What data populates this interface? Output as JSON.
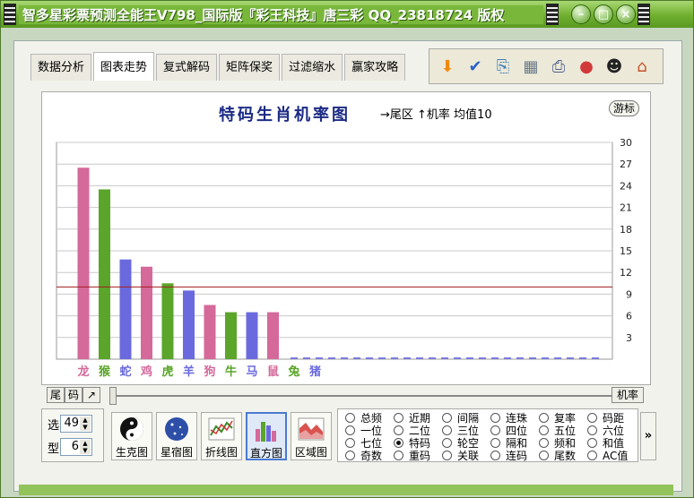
{
  "window": {
    "title": "智多星彩票预测全能王V798_国际版『彩王科技』唐三彩 QQ_23818724 版权",
    "controls": {
      "minimize": "–",
      "maximize": "□",
      "close": "×"
    }
  },
  "tabs": [
    "数据分析",
    "图表走势",
    "复式解码",
    "矩阵保奖",
    "过滤缩水",
    "赢家攻略"
  ],
  "active_tab": 1,
  "toolbar_icons": [
    "down-arrow-icon",
    "spellcheck-abc-icon",
    "export-icon",
    "calculator-icon",
    "printer-icon",
    "gumball-icon",
    "qq-penguin-icon",
    "home-icon"
  ],
  "chart_header": {
    "title": "特码生肖机率图",
    "subtitle": "→尾区 ↑机率 均值10",
    "tour_button": "游标"
  },
  "chart_data": {
    "type": "bar",
    "title": "特码生肖机率图",
    "categories": [
      "龙",
      "猴",
      "蛇",
      "鸡",
      "虎",
      "羊",
      "狗",
      "牛",
      "马",
      "鼠",
      "兔",
      "猪"
    ],
    "values": [
      26.5,
      23.5,
      13.8,
      12.8,
      10.5,
      9.5,
      7.5,
      6.5,
      6.5,
      6.5,
      0,
      0
    ],
    "category_colors": [
      "#d4699a",
      "#5aa52a",
      "#6a6ade",
      "#d4699a",
      "#5aa52a",
      "#6a6ade",
      "#d4699a",
      "#5aa52a",
      "#6a6ade",
      "#d4699a",
      "#5aa52a",
      "#6a6ade"
    ],
    "y_ticks": [
      3,
      6,
      9,
      12,
      15,
      18,
      21,
      24,
      27,
      30
    ],
    "ylim": [
      0,
      30
    ],
    "axis_side": "right",
    "mean_line": 10,
    "mean_line_color": "#a31e1e",
    "grid": true
  },
  "nav": {
    "tail": "尾",
    "code": "码",
    "expand": "↗",
    "probability": "机率"
  },
  "spin": {
    "select_label": "选",
    "select_value": "49",
    "type_label": "型",
    "type_value": "6"
  },
  "chart_modes": [
    {
      "label": "生克图",
      "icon": "yin-yang-icon"
    },
    {
      "label": "星宿图",
      "icon": "star-globe-icon"
    },
    {
      "label": "折线图",
      "icon": "line-chart-icon"
    },
    {
      "label": "直方图",
      "icon": "bar-chart-icon"
    },
    {
      "label": "区域图",
      "icon": "area-chart-icon"
    }
  ],
  "active_mode": 3,
  "radio_columns": [
    [
      "总频",
      "一位",
      "七位",
      "奇数"
    ],
    [
      "近期",
      "二位",
      "特码",
      "重码"
    ],
    [
      "间隔",
      "三位",
      "轮空",
      "关联"
    ],
    [
      "连珠",
      "四位",
      "隔和",
      "连码"
    ],
    [
      "复率",
      "五位",
      "频和",
      "尾数"
    ],
    [
      "码距",
      "六位",
      "和值",
      "AC值"
    ]
  ],
  "selected_radio": "特码",
  "more_button": "»"
}
